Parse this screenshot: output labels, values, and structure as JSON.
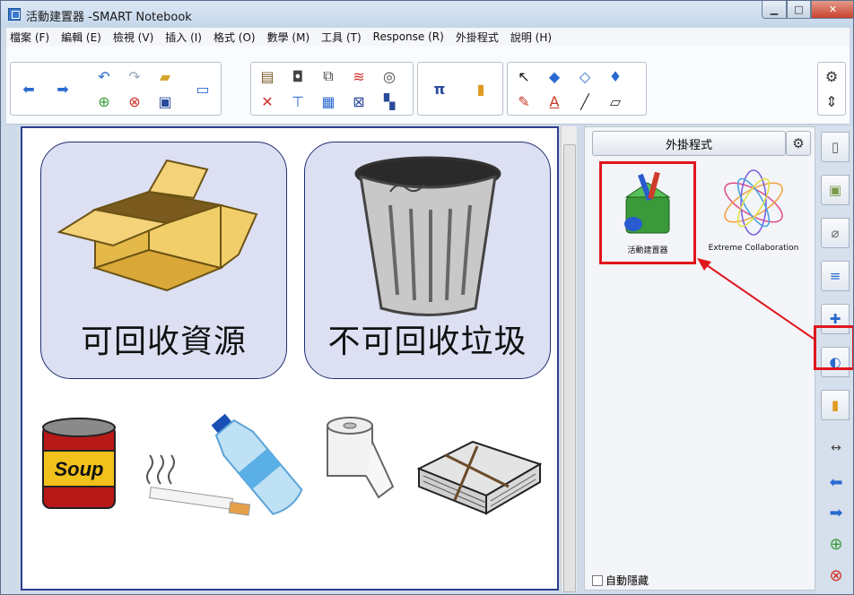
{
  "window": {
    "title": "活動建置器 -SMART Notebook"
  },
  "menu": [
    "檔案 (F)",
    "編輯 (E)",
    "檢視 (V)",
    "插入 (I)",
    "格式 (O)",
    "數學 (M)",
    "工具 (T)",
    "Response (R)",
    "外掛程式",
    "說明 (H)"
  ],
  "canvas": {
    "card_left_label": "可回收資源",
    "card_right_label": "不可回收垃圾",
    "can_label": "Soup"
  },
  "side_panel": {
    "header": "外掛程式",
    "addons": [
      {
        "label": "活動建置器",
        "icon": "toolbox-icon"
      },
      {
        "label": "Extreme Collaboration",
        "icon": "spiral-flower-icon"
      }
    ],
    "autohide_label": "自動隱藏"
  },
  "colors": {
    "highlight": "#e0161e",
    "border": "#2c3e8c",
    "card_fill": "#dde0f3"
  }
}
